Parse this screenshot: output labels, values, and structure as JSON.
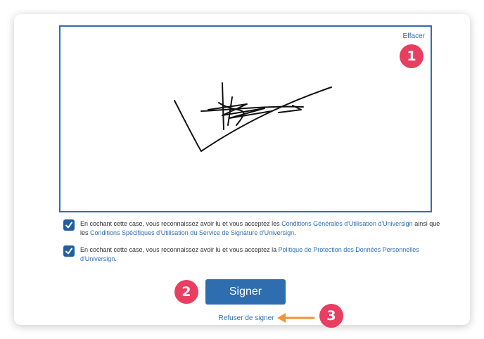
{
  "signature_pad": {
    "clear_label": "Effacer"
  },
  "consents": [
    {
      "text_before": "En cochant cette case, vous reconnaissez avoir lu et vous acceptez les ",
      "link1": "Conditions Générales d'Utilisation d'Universign",
      "text_middle": " ainsi que les ",
      "link2": "Conditions Spécifiques d'Utilisation du Service de Signature d'Universign",
      "text_after": ".",
      "checked": true
    },
    {
      "text_before": "En cochant cette case, vous reconnaissez avoir lu et vous acceptez la ",
      "link1": "Politique de Protection des Données Personnelles d'Universign",
      "text_after": ".",
      "checked": true
    }
  ],
  "actions": {
    "sign_label": "Signer",
    "refuse_label": "Refuser de signer"
  },
  "annotations": {
    "badge1": "1",
    "badge2": "2",
    "badge3": "3"
  },
  "colors": {
    "accent": "#2e6eb0",
    "badge": "#e83e62",
    "arrow": "#f0943a"
  }
}
